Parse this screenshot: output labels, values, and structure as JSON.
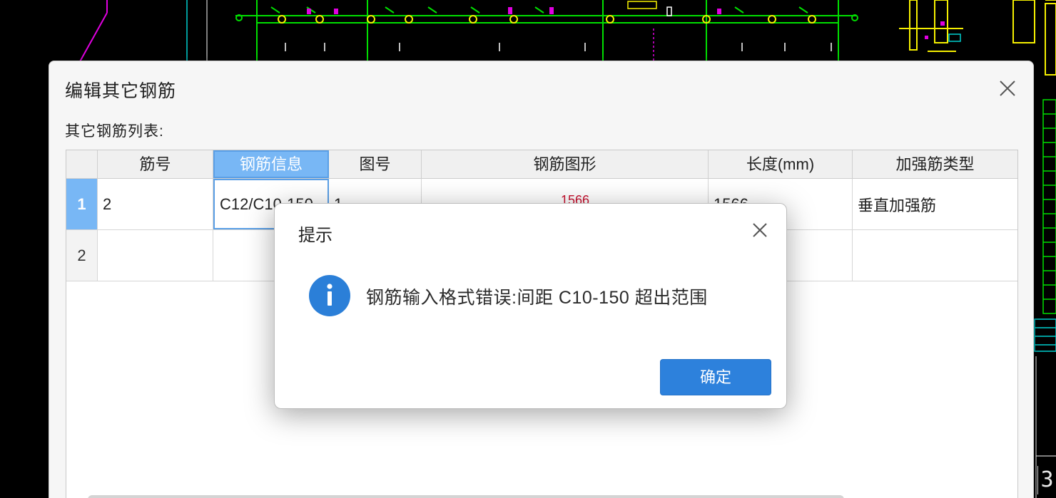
{
  "colors": {
    "accent": "#2d81dc",
    "selection": "#78b7f5",
    "cad_green": "#00e000",
    "cad_yellow": "#f5ef00",
    "cad_magenta": "#e000e0",
    "cad_cyan": "#00d0d0",
    "shape_number": "#c8102e"
  },
  "cad": {
    "corner_label": "3"
  },
  "main_dialog": {
    "title": "编辑其它钢筋",
    "list_label": "其它钢筋列表:",
    "close_icon": "close-icon",
    "columns": [
      "",
      "筋号",
      "钢筋信息",
      "图号",
      "钢筋图形",
      "长度(mm)",
      "加强筋类型"
    ],
    "selected_column": 2,
    "rows": [
      {
        "index": "1",
        "bar_no": "2",
        "bar_info": "C12/C10-150",
        "shape_code": "1",
        "shape_value": "1566",
        "length": "1566",
        "type": "垂直加强筋"
      },
      {
        "index": "2",
        "bar_no": "",
        "bar_info": "",
        "shape_code": "",
        "shape_value": "",
        "length": "",
        "type": ""
      }
    ]
  },
  "message_box": {
    "title": "提示",
    "message": "钢筋输入格式错误:间距 C10-150 超出范围",
    "ok_label": "确定",
    "icon": "info-icon",
    "close_icon": "close-icon"
  }
}
